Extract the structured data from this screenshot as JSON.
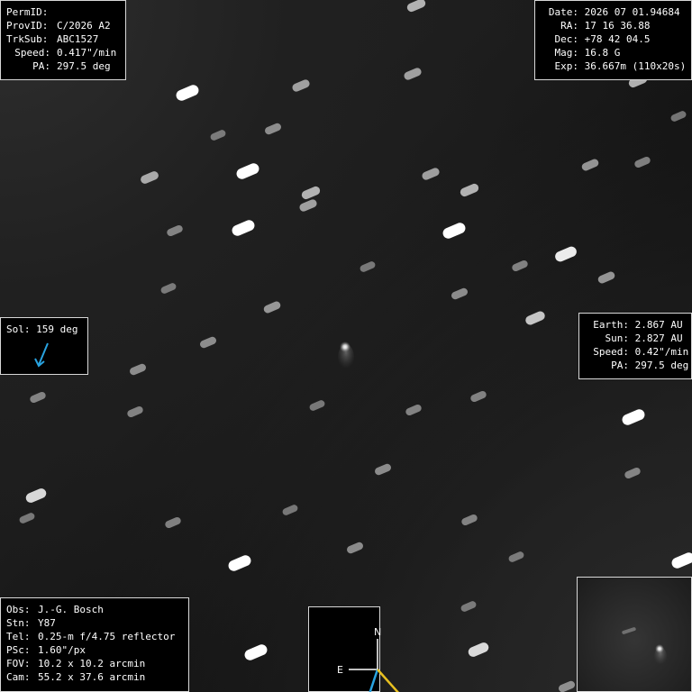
{
  "identification": {
    "perm_id": {
      "label": "PermID:",
      "value": ""
    },
    "prov_id": {
      "label": "ProvID:",
      "value": "C/2026 A2"
    },
    "trk_sub": {
      "label": "TrkSub:",
      "value": "ABC1527"
    },
    "speed": {
      "label": "Speed:",
      "value": "0.417\"/min"
    },
    "pa": {
      "label": "PA:",
      "value": "297.5 deg"
    }
  },
  "observation": {
    "date": {
      "label": "Date:",
      "value": "2026 07 01.94684"
    },
    "ra": {
      "label": "RA:",
      "value": "17 16 36.88"
    },
    "dec": {
      "label": "Dec:",
      "value": "+78 42 04.5"
    },
    "mag": {
      "label": "Mag:",
      "value": "16.8 G"
    },
    "exp": {
      "label": "Exp:",
      "value": "36.667m (110x20s)"
    }
  },
  "geometry": {
    "earth": {
      "label": "Earth:",
      "value": "2.867 AU"
    },
    "sun": {
      "label": "Sun:",
      "value": "2.827 AU"
    },
    "speed": {
      "label": "Speed:",
      "value": "0.42\"/min"
    },
    "pa": {
      "label": "PA:",
      "value": "297.5 deg"
    }
  },
  "solar": {
    "label": "Sol:",
    "value": "159 deg",
    "arrow_color": "#29a3e0"
  },
  "observer": {
    "obs": {
      "label": "Obs:",
      "value": "J.-G. Bosch"
    },
    "stn": {
      "label": "Stn:",
      "value": "Y87"
    },
    "tel": {
      "label": "Tel:",
      "value": "0.25-m f/4.75 reflector"
    },
    "psc": {
      "label": "PSc:",
      "value": "1.60\"/px"
    },
    "fov": {
      "label": "FOV:",
      "value": "10.2 x 10.2 arcmin"
    },
    "cam": {
      "label": "Cam:",
      "value": "55.2 x 37.6 arcmin"
    }
  },
  "compass": {
    "north": "N",
    "east": "E",
    "motion_color": "#29a3e0",
    "sun_color": "#e8c020"
  },
  "image": {
    "subject": "comet",
    "star_trail_color": "#ffffff"
  }
}
